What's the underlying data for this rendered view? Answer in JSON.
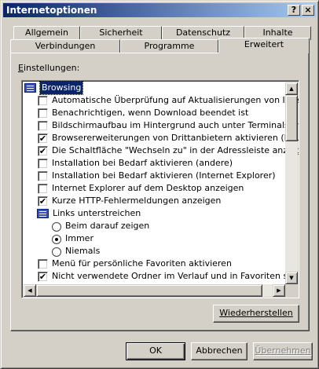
{
  "window": {
    "title": "Internetoptionen",
    "help_glyph": "?",
    "close_glyph": "×"
  },
  "tabs_back": [
    "Allgemein",
    "Sicherheit",
    "Datenschutz",
    "Inhalte"
  ],
  "tabs_front": [
    "Verbindungen",
    "Programme",
    "Erweitert"
  ],
  "active_tab": "Erweitert",
  "settings": {
    "label_prefix": "E",
    "label_rest": "instellungen:",
    "items": [
      {
        "kind": "group",
        "label": "Browsing",
        "icon": "settings-folder-icon",
        "selected": true
      },
      {
        "kind": "checkbox",
        "label": "Automatische Überprüfung auf Aktualisierungen von Internet Ex",
        "checked": false
      },
      {
        "kind": "checkbox",
        "label": "Benachrichtigen, wenn Download beendet ist",
        "checked": false
      },
      {
        "kind": "checkbox",
        "label": "Bildschirmaufbau im Hintergrund auch unter Terminalserver erzw",
        "checked": false
      },
      {
        "kind": "checkbox",
        "label": "Browsererweiterungen von Drittanbietern aktivieren (Neustart e",
        "checked": true
      },
      {
        "kind": "checkbox",
        "label": "Die Schaltfläche \"Wechseln zu\" in der Adressleiste anzeigen",
        "checked": true
      },
      {
        "kind": "checkbox",
        "label": "Installation bei Bedarf aktivieren (andere)",
        "checked": false
      },
      {
        "kind": "checkbox",
        "label": "Installation bei Bedarf aktivieren (Internet Explorer)",
        "checked": false
      },
      {
        "kind": "checkbox",
        "label": "Internet Explorer auf dem Desktop anzeigen",
        "checked": false
      },
      {
        "kind": "checkbox",
        "label": "Kurze HTTP-Fehlermeldungen anzeigen",
        "checked": true
      },
      {
        "kind": "subgroup",
        "label": "Links unterstreichen",
        "icon": "subgroup-icon"
      },
      {
        "kind": "radio",
        "label": "Beim darauf zeigen",
        "checked": false
      },
      {
        "kind": "radio",
        "label": "Immer",
        "checked": true
      },
      {
        "kind": "radio",
        "label": "Niemals",
        "checked": false
      },
      {
        "kind": "checkbox",
        "label": "Menü für persönliche Favoriten aktivieren",
        "checked": false
      },
      {
        "kind": "checkbox",
        "label": "Nicht verwendete Ordner im Verlauf und in Favoriten schließen",
        "checked": true
      }
    ]
  },
  "buttons": {
    "restore": "Wiederherstellen",
    "ok": "OK",
    "cancel": "Abbrechen",
    "apply": "Übernehmen"
  },
  "check_glyph": "✔",
  "scroll_glyphs": {
    "up": "▲",
    "down": "▼",
    "left": "◀",
    "right": "▶"
  }
}
